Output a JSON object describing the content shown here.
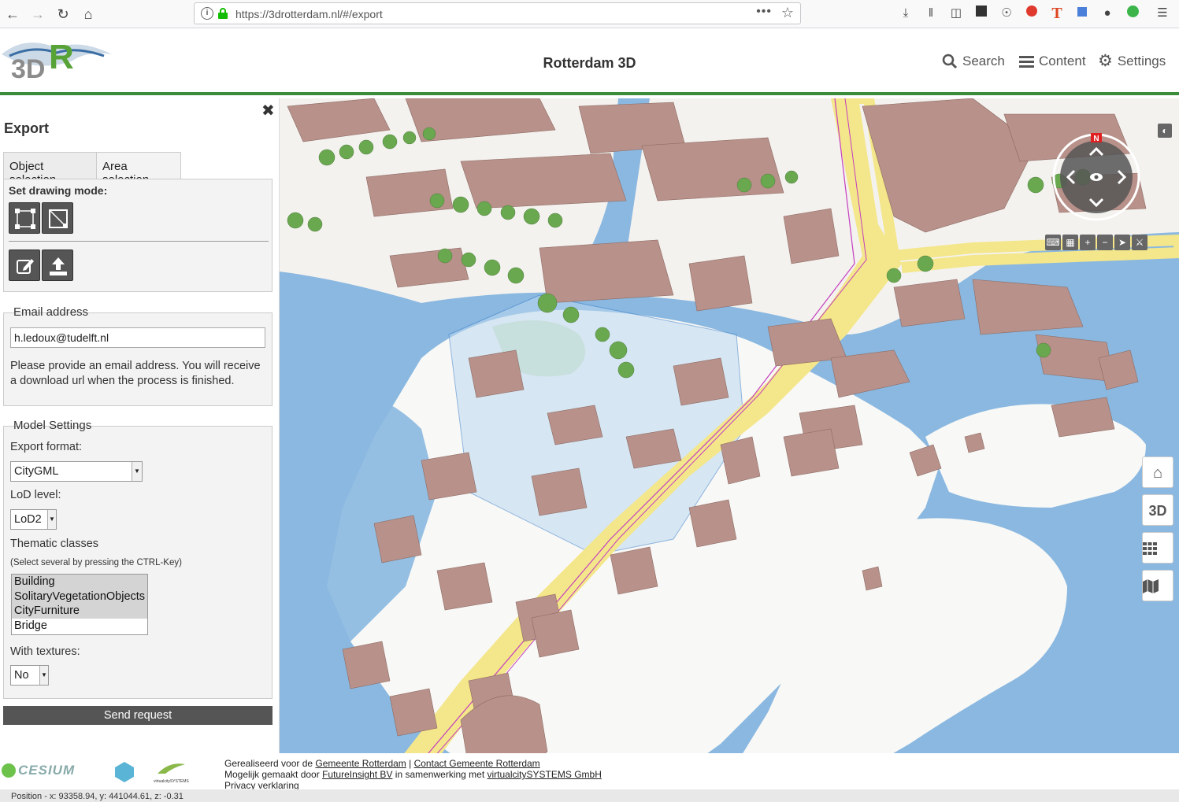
{
  "browser": {
    "url": "https://3drotterdam.nl/#/export",
    "more_label": "•••"
  },
  "header": {
    "logo_text": "3DR",
    "title": "Rotterdam 3D",
    "search_label": "Search",
    "content_label": "Content",
    "settings_label": "Settings"
  },
  "panel": {
    "close_label": "✖",
    "title": "Export",
    "tabs": [
      {
        "label": "Object selection"
      },
      {
        "label": "Area selection"
      }
    ],
    "drawing_mode_label": "Set drawing mode:",
    "email": {
      "legend": "Email address",
      "value": "h.ledoux@tudelft.nl",
      "help": "Please provide an email address. You will receive a download url when the process is finished."
    },
    "model": {
      "legend": "Model Settings",
      "export_format_label": "Export format:",
      "export_format_value": "CityGML",
      "lod_label": "LoD level:",
      "lod_value": "LoD2",
      "thematic_label": "Thematic classes",
      "thematic_hint": "(Select several by pressing the CTRL-Key)",
      "thematic_options": [
        "Building",
        "SolitaryVegetationObjects",
        "CityFurniture",
        "Bridge"
      ],
      "textures_label": "With textures:",
      "textures_value": "No"
    },
    "send_label": "Send request"
  },
  "map": {
    "compass_north": "N",
    "btn_3d": "3D"
  },
  "footer": {
    "cesium_label": "CESIUM",
    "line1_prefix": "Gerealiseerd voor de ",
    "line1_link1": "Gemeente Rotterdam",
    "line1_sep": " | ",
    "line1_link2": "Contact Gemeente Rotterdam",
    "line2_prefix": "Mogelijk gemaakt door ",
    "line2_link1": "FutureInsight BV",
    "line2_mid": " in samenwerking met ",
    "line2_link2": "virtualcitySYSTEMS GmbH",
    "line3_link": "Privacy verklaring",
    "vcs_label": "virtualcitySYSTEMS"
  },
  "status": {
    "position": "Position - x: 93358.94, y: 441044.61, z: -0.31"
  },
  "colors": {
    "accent_green": "#3a8b3a",
    "water": "#8ab8e0",
    "building": "#b8918a",
    "road": "#f4e68a"
  }
}
